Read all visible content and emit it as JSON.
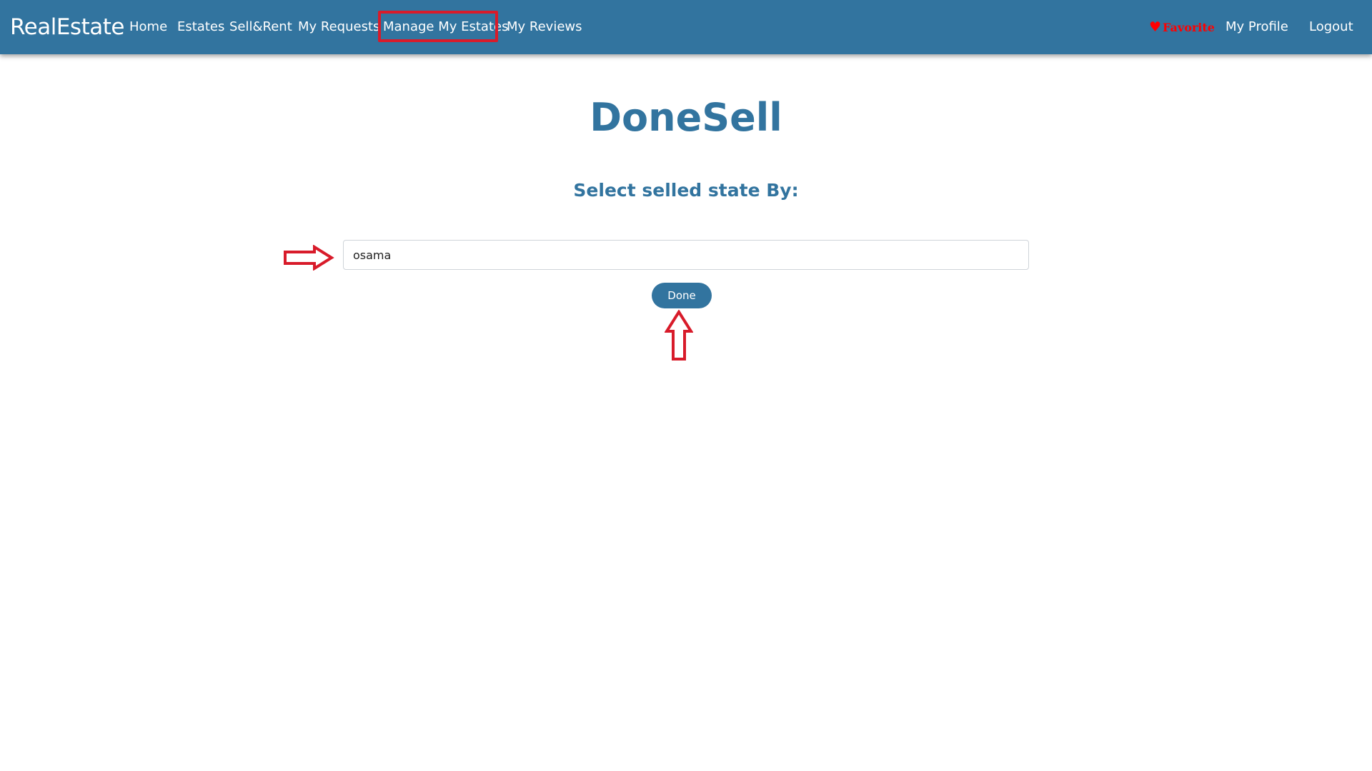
{
  "navbar": {
    "brand": "RealEstate",
    "links": [
      {
        "label": "Home"
      },
      {
        "label": "Estates"
      },
      {
        "label": "Sell&Rent"
      },
      {
        "label": "My Requests"
      },
      {
        "label": "Manage My Estates"
      },
      {
        "label": "My Reviews"
      }
    ],
    "favorite": "Favorite",
    "profile": "My Profile",
    "logout": "Logout",
    "background_color": "#32749f",
    "highlight_color": "#d81b2a",
    "favorite_color": "#ff0000",
    "favorite_icon": "heart-icon"
  },
  "main": {
    "title": "DoneSell",
    "subtitle": "Select selled state By:",
    "input_value": "osama",
    "done_label": "Done",
    "accent_color": "#32749f",
    "annotation_arrow_color": "#d81b2a",
    "annotation_icons": [
      "arrow-right-icon",
      "arrow-up-icon"
    ]
  }
}
